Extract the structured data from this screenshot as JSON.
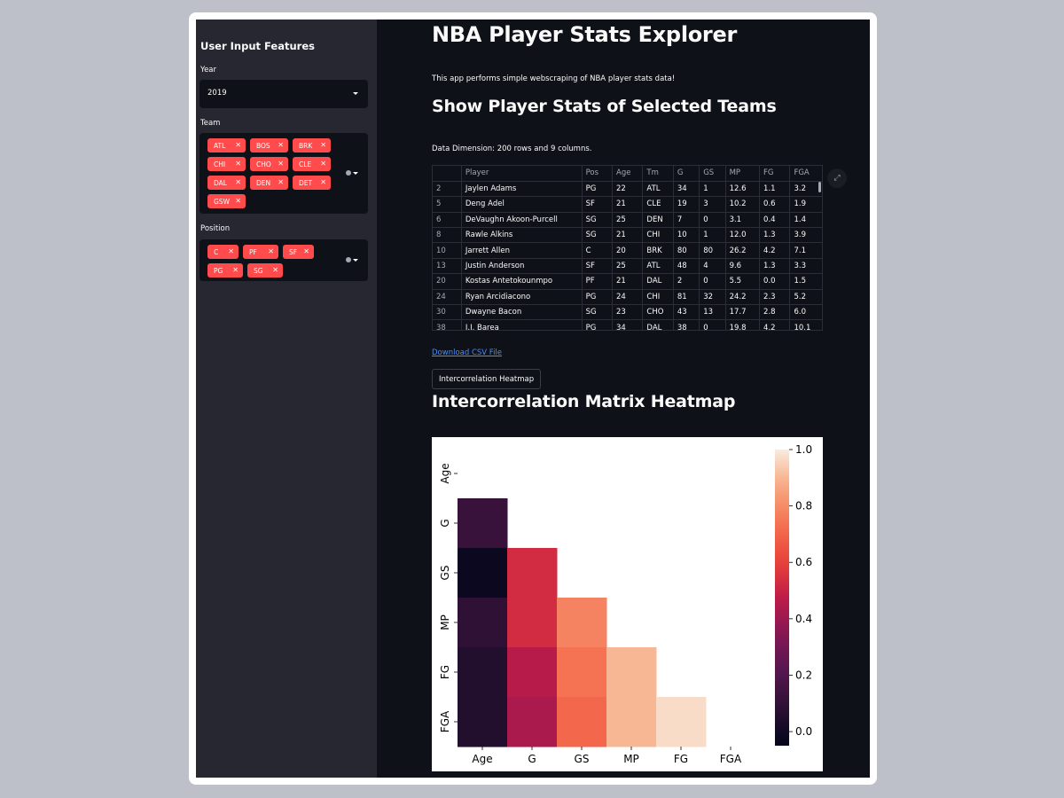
{
  "sidebar": {
    "header": "User Input Features",
    "year": {
      "label": "Year",
      "value": "2019"
    },
    "team": {
      "label": "Team",
      "selected": [
        "ATL",
        "BOS",
        "BRK",
        "CHI",
        "CHO",
        "CLE",
        "DAL",
        "DEN",
        "DET",
        "GSW"
      ]
    },
    "position": {
      "label": "Position",
      "selected": [
        "C",
        "PF",
        "SF",
        "PG",
        "SG"
      ]
    }
  },
  "main": {
    "title": "NBA Player Stats Explorer",
    "intro": "This app performs simple webscraping of NBA player stats data!",
    "section1_title": "Show Player Stats of Selected Teams",
    "dimension_text": "Data Dimension: 200 rows and 9 columns.",
    "table": {
      "columns": [
        "",
        "Player",
        "Pos",
        "Age",
        "Tm",
        "G",
        "GS",
        "MP",
        "FG",
        "FGA"
      ],
      "rows": [
        [
          "2",
          "Jaylen Adams",
          "PG",
          "22",
          "ATL",
          "34",
          "1",
          "12.6",
          "1.1",
          "3.2"
        ],
        [
          "5",
          "Deng Adel",
          "SF",
          "21",
          "CLE",
          "19",
          "3",
          "10.2",
          "0.6",
          "1.9"
        ],
        [
          "6",
          "DeVaughn Akoon-Purcell",
          "SG",
          "25",
          "DEN",
          "7",
          "0",
          "3.1",
          "0.4",
          "1.4"
        ],
        [
          "8",
          "Rawle Alkins",
          "SG",
          "21",
          "CHI",
          "10",
          "1",
          "12.0",
          "1.3",
          "3.9"
        ],
        [
          "10",
          "Jarrett Allen",
          "C",
          "20",
          "BRK",
          "80",
          "80",
          "26.2",
          "4.2",
          "7.1"
        ],
        [
          "13",
          "Justin Anderson",
          "SF",
          "25",
          "ATL",
          "48",
          "4",
          "9.6",
          "1.3",
          "3.3"
        ],
        [
          "20",
          "Kostas Antetokounmpo",
          "PF",
          "21",
          "DAL",
          "2",
          "0",
          "5.5",
          "0.0",
          "1.5"
        ],
        [
          "24",
          "Ryan Arcidiacono",
          "PG",
          "24",
          "CHI",
          "81",
          "32",
          "24.2",
          "2.3",
          "5.2"
        ],
        [
          "30",
          "Dwayne Bacon",
          "SG",
          "23",
          "CHO",
          "43",
          "13",
          "17.7",
          "2.8",
          "6.0"
        ],
        [
          "38",
          "J.J. Barea",
          "PG",
          "34",
          "DAL",
          "38",
          "0",
          "19.8",
          "4.2",
          "10.1"
        ]
      ]
    },
    "download_link": "Download CSV File",
    "heatmap_button": "Intercorrelation Heatmap",
    "section2_title": "Intercorrelation Matrix Heatmap"
  },
  "chart_data": {
    "type": "heatmap",
    "title": "",
    "xlabels": [
      "Age",
      "G",
      "GS",
      "MP",
      "FG",
      "FGA"
    ],
    "ylabels": [
      "Age",
      "G",
      "GS",
      "MP",
      "FG",
      "FGA"
    ],
    "mask": "upper-triangle-including-diagonal",
    "values": [
      [
        null,
        null,
        null,
        null,
        null,
        null
      ],
      [
        0.12,
        null,
        null,
        null,
        null,
        null
      ],
      [
        -0.02,
        0.53,
        null,
        null,
        null,
        null
      ],
      [
        0.09,
        0.53,
        0.78,
        null,
        null,
        null
      ],
      [
        0.05,
        0.46,
        0.74,
        0.9,
        null,
        null
      ],
      [
        0.05,
        0.43,
        0.71,
        0.9,
        0.97,
        null
      ]
    ],
    "colorbar": {
      "min": -0.05,
      "max": 1.0,
      "ticks": [
        "0.0",
        "0.2",
        "0.4",
        "0.6",
        "0.8",
        "1.0"
      ]
    },
    "colormap": "rocket"
  }
}
